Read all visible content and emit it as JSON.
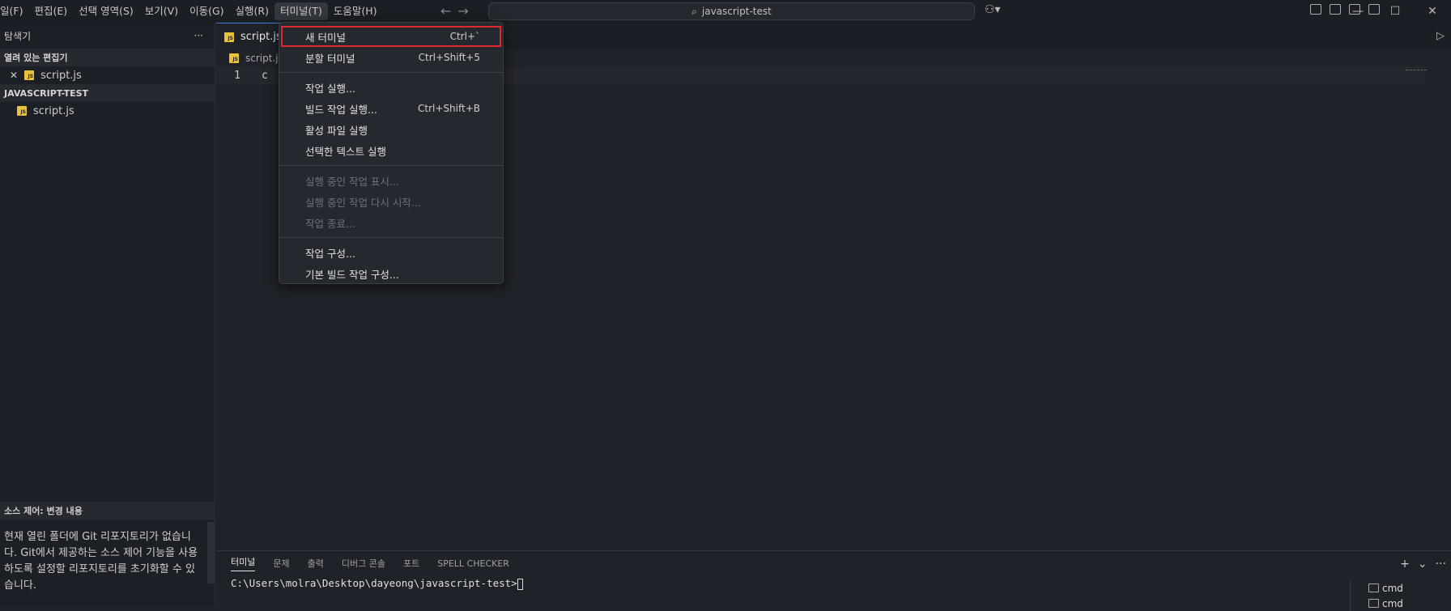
{
  "menubar": {
    "items": [
      "일(F)",
      "편집(E)",
      "선택 영역(S)",
      "보기(V)",
      "이동(G)",
      "실행(R)",
      "터미널(T)",
      "도움말(H)"
    ],
    "active_index": 6
  },
  "search": {
    "text": "javascript-test"
  },
  "sidebar": {
    "title": "탐색기",
    "open_editors_label": "열려 있는 편집기",
    "open_editor_file": "script.js",
    "workspace_label": "JAVASCRIPT-TEST",
    "workspace_file": "script.js",
    "scm_header": "소스 제어: 변경 내용",
    "scm_message": "현재 열린 폴더에 Git 리포지토리가 없습니다. Git에서 제공하는 소스 제어 기능을 사용하도록 설정할 리포지토리를 초기화할 수 있습니다."
  },
  "editor": {
    "tab_label": "script.js",
    "breadcrumb": "script.js",
    "line_number": "1",
    "line_text": "c"
  },
  "panel": {
    "tabs": [
      "터미널",
      "문제",
      "출력",
      "디버그 콘솔",
      "포트",
      "SPELL CHECKER"
    ],
    "terminal_prompt": "C:\\Users\\molra\\Desktop\\dayeong\\javascript-test>",
    "terminals": [
      "cmd",
      "cmd"
    ]
  },
  "dropdown": {
    "items": [
      {
        "label": "새 터미널",
        "shortcut": "Ctrl+`",
        "highlight": true
      },
      {
        "label": "분할 터미널",
        "shortcut": "Ctrl+Shift+5"
      },
      {
        "label": "작업 실행...",
        "shortcut": ""
      },
      {
        "label": "빌드 작업 실행...",
        "shortcut": "Ctrl+Shift+B"
      },
      {
        "label": "활성 파일 실행",
        "shortcut": ""
      },
      {
        "label": "선택한 텍스트 실행",
        "shortcut": ""
      },
      {
        "label": "실행 중인 작업 표시...",
        "shortcut": "",
        "disabled": true
      },
      {
        "label": "실행 중인 작업 다시 시작...",
        "shortcut": "",
        "disabled": true
      },
      {
        "label": "작업 종료...",
        "shortcut": "",
        "disabled": true
      },
      {
        "label": "작업 구성...",
        "shortcut": ""
      },
      {
        "label": "기본 빌드 작업 구성...",
        "shortcut": ""
      }
    ]
  },
  "colors": {
    "highlight_border": "#e0282e",
    "js_icon": "#e8c33a"
  }
}
